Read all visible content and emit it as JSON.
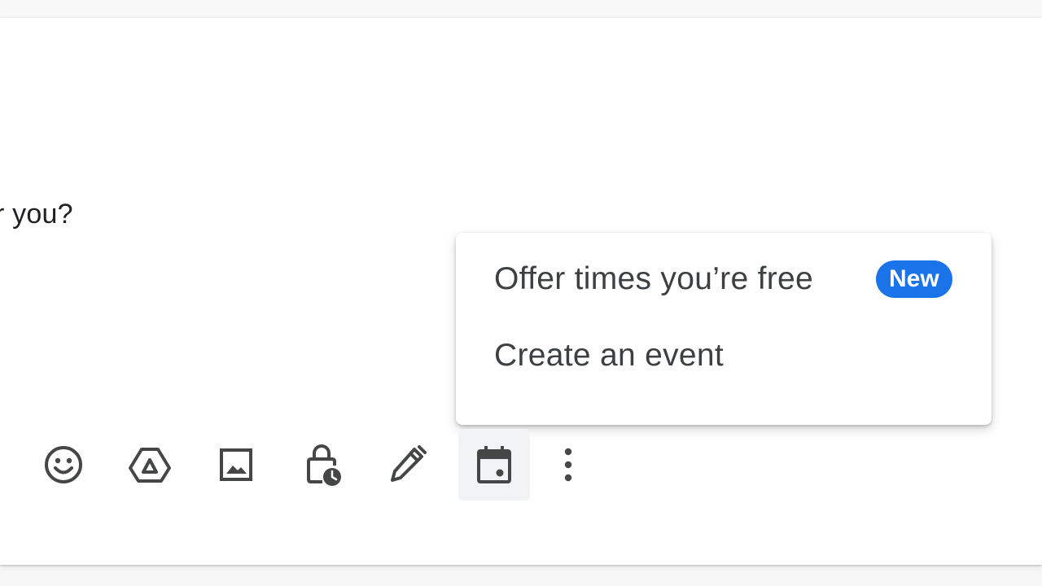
{
  "compose": {
    "body_text": "r you?"
  },
  "calendar_menu": {
    "items": [
      {
        "label": "Offer times you’re free",
        "badge": "New"
      },
      {
        "label": "Create an event"
      }
    ]
  },
  "toolbar": {
    "buttons": [
      {
        "icon": "emoji-icon"
      },
      {
        "icon": "google-drive-icon"
      },
      {
        "icon": "insert-photo-icon"
      },
      {
        "icon": "confidential-mode-icon"
      },
      {
        "icon": "signature-pen-icon"
      },
      {
        "icon": "calendar-icon",
        "active": true
      },
      {
        "icon": "more-options-icon"
      }
    ]
  },
  "colors": {
    "badge_background": "#1a73e8",
    "icon": "#444746",
    "active_button_background": "#f1f3f4"
  }
}
